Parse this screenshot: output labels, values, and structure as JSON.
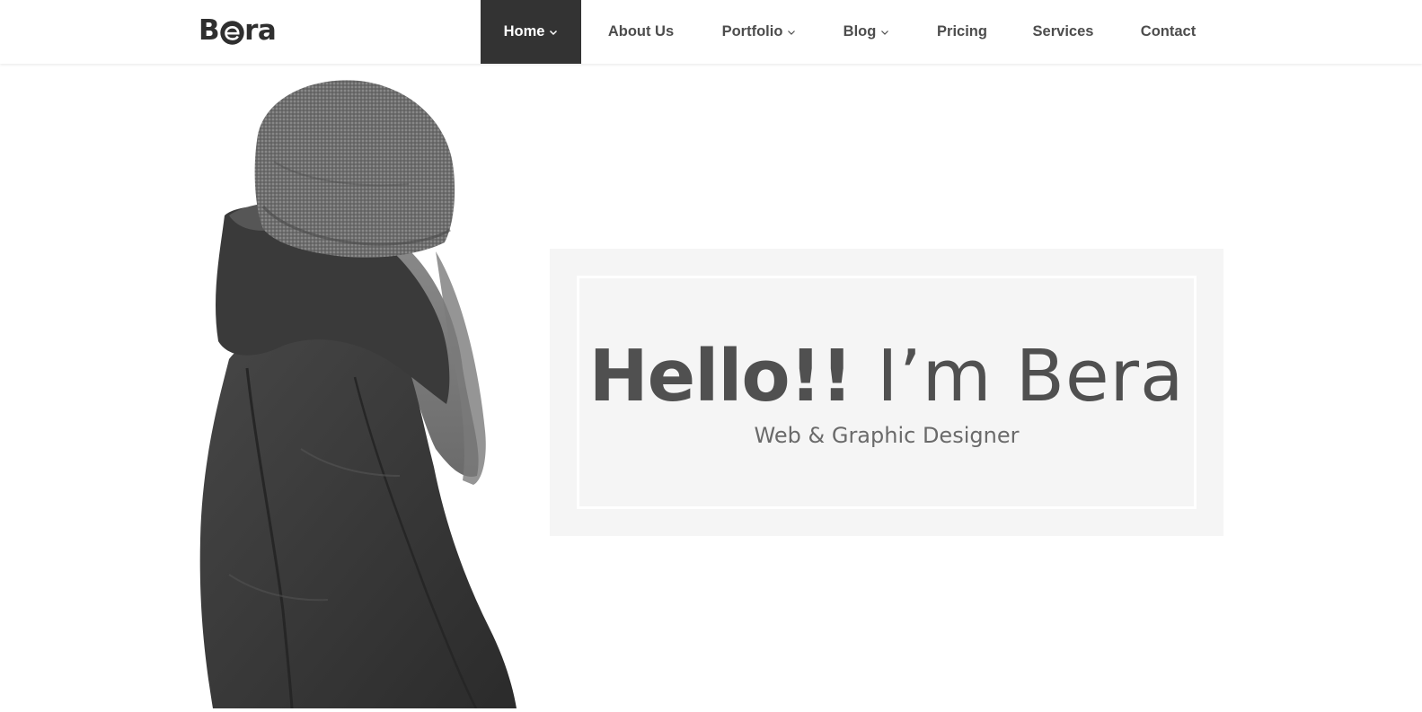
{
  "brand": {
    "logo_prefix": "B",
    "logo_suffix": "ra",
    "logo_full": "Bera"
  },
  "nav": {
    "items": [
      {
        "label": "Home",
        "active": true,
        "has_dropdown": true
      },
      {
        "label": "About Us",
        "active": false,
        "has_dropdown": false
      },
      {
        "label": "Portfolio",
        "active": false,
        "has_dropdown": true
      },
      {
        "label": "Blog",
        "active": false,
        "has_dropdown": true
      },
      {
        "label": "Pricing",
        "active": false,
        "has_dropdown": false
      },
      {
        "label": "Services",
        "active": false,
        "has_dropdown": false
      },
      {
        "label": "Contact",
        "active": false,
        "has_dropdown": false
      }
    ]
  },
  "hero": {
    "greeting": "Hello!!",
    "name_line": "I’m Bera",
    "subtitle": "Web & Graphic Designer",
    "image": "woman-in-beanie-and-jacket-grayscale"
  },
  "colors": {
    "nav_active_bg": "#333333",
    "nav_text": "#4d4d4d",
    "hero_box_bg": "#f5f5f5",
    "hero_border": "#ffffff",
    "title_text": "#505050"
  }
}
